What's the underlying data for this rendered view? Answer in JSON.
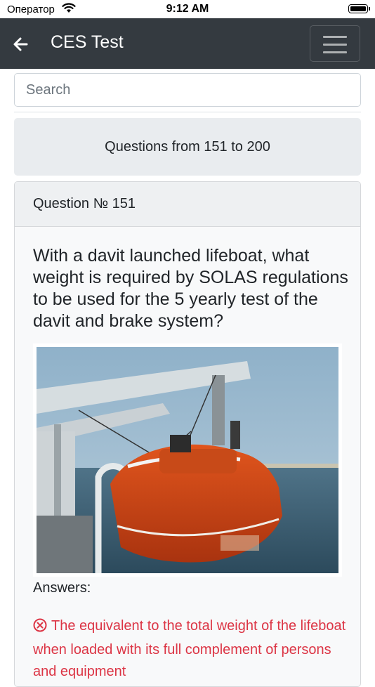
{
  "status_bar": {
    "carrier": "Оператор",
    "time": "9:12 AM"
  },
  "navbar": {
    "title": "CES Test",
    "bg_color": "#343a40"
  },
  "search": {
    "placeholder": "Search",
    "value": ""
  },
  "range": {
    "label": "Questions from 151 to 200"
  },
  "question": {
    "header": "Question № 151",
    "text": "With a davit launched lifeboat, what weight is required by SOLAS regulations to be used for the 5 yearly test of the davit and brake system?",
    "image": "lifeboat-davit-photo",
    "answers_label": "Answers:",
    "answers": [
      {
        "text": "The equivalent to the total weight of the lifeboat when loaded with its full complement of persons and equipment",
        "status": "incorrect",
        "icon": "x-circle-icon",
        "color": "#dc3545"
      }
    ]
  }
}
